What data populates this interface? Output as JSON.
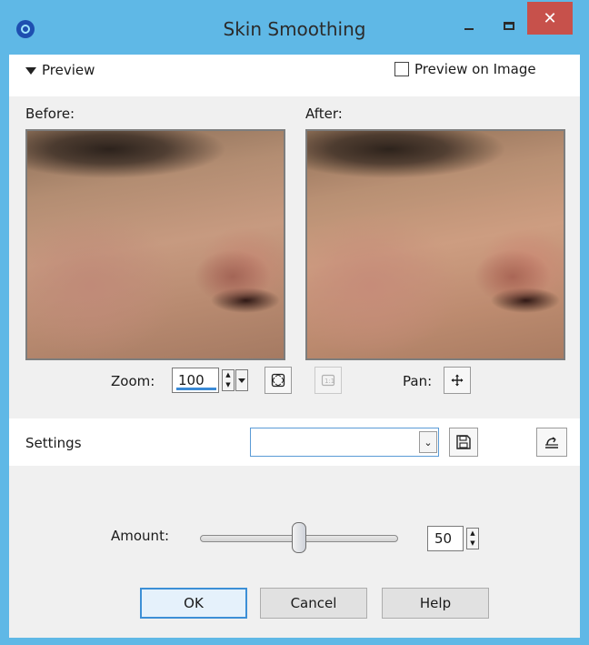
{
  "window": {
    "title": "Skin Smoothing",
    "close_glyph": "✕"
  },
  "preview_section": {
    "label": "Preview",
    "preview_on_image_label": "Preview on Image",
    "preview_on_image_checked": false
  },
  "before": {
    "label": "Before:"
  },
  "after": {
    "label": "After:"
  },
  "zoom": {
    "label": "Zoom:",
    "value": "100"
  },
  "pan": {
    "label": "Pan:"
  },
  "settings": {
    "label": "Settings",
    "selected": ""
  },
  "amount": {
    "label": "Amount:",
    "value": "50",
    "slider_fraction": 0.5
  },
  "buttons": {
    "ok": "OK",
    "cancel": "Cancel",
    "help": "Help"
  },
  "icons": {
    "preview_toggle": "triangle-down-icon",
    "zoom_fit": "fit-to-window-icon",
    "zoom_actual": "actual-size-icon",
    "pan": "move-cross-icon",
    "save_preset": "floppy-disk-icon",
    "reset": "reset-icon"
  },
  "colors": {
    "titlebar": "#5fb8e6",
    "close_button": "#c7514b",
    "default_button_border": "#3c8fd6"
  }
}
